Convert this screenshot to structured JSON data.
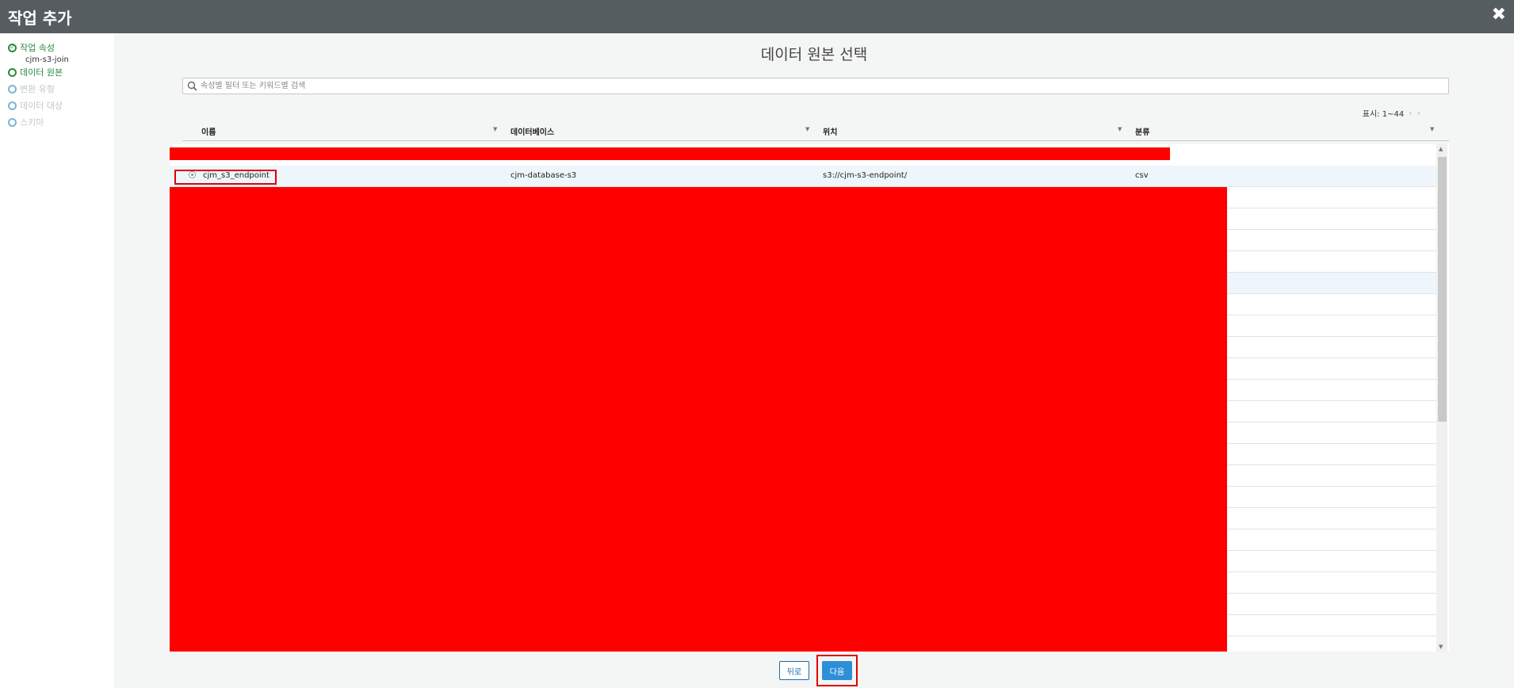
{
  "header": {
    "title": "작업 추가",
    "close_icon": "✖"
  },
  "sidebar": {
    "steps": [
      {
        "label": "작업 속성",
        "state": "done",
        "sub": "cjm-s3-join"
      },
      {
        "label": "데이터 원본",
        "state": "active"
      },
      {
        "label": "변환 유형",
        "state": "disabled"
      },
      {
        "label": "데이터 대상",
        "state": "disabled"
      },
      {
        "label": "스키마",
        "state": "disabled"
      }
    ]
  },
  "main": {
    "title": "데이터 원본 선택",
    "search_placeholder": "속성별 필터 또는 키워드별 검색",
    "pager": {
      "label": "표시: 1~44",
      "prev": "‹",
      "next": "›"
    },
    "columns": [
      "이름",
      "데이터베이스",
      "위치",
      "분류"
    ],
    "rows": [
      {
        "name": "cjm_s3_endpoint",
        "database": "cjm-database-s3",
        "location": "s3://cjm-s3-endpoint/",
        "classification": "csv",
        "selected": true
      }
    ],
    "buttons": {
      "back": "뒤로",
      "next": "다음"
    }
  },
  "colors": {
    "header_bg": "#555d60",
    "accent": "#2d8fd6",
    "done": "#2a8a3e",
    "redaction": "#ff0000"
  }
}
